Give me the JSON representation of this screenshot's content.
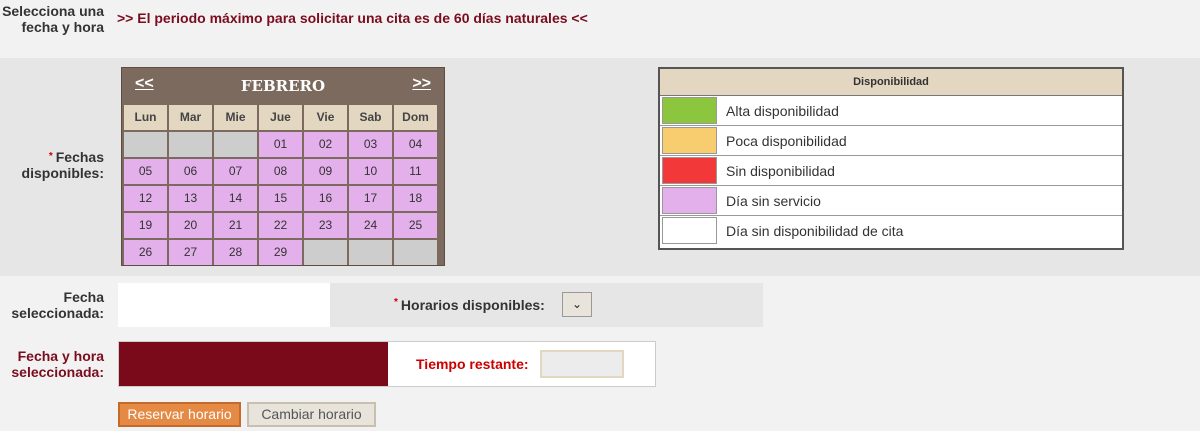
{
  "header": {
    "label": "Selecciona una fecha y hora",
    "notice": ">> El periodo máximo para solicitar una cita es de 60 días naturales <<"
  },
  "dates": {
    "required_mark": "*",
    "label": "Fechas disponibles:"
  },
  "calendar": {
    "prev": "<<",
    "next": ">>",
    "month": "FEBRERO",
    "weekdays": [
      "Lun",
      "Mar",
      "Mie",
      "Jue",
      "Vie",
      "Sab",
      "Dom"
    ],
    "weeks": [
      [
        "",
        "",
        "",
        "01",
        "02",
        "03",
        "04"
      ],
      [
        "05",
        "06",
        "07",
        "08",
        "09",
        "10",
        "11"
      ],
      [
        "12",
        "13",
        "14",
        "15",
        "16",
        "17",
        "18"
      ],
      [
        "19",
        "20",
        "21",
        "22",
        "23",
        "24",
        "25"
      ],
      [
        "26",
        "27",
        "28",
        "29",
        "",
        "",
        ""
      ]
    ],
    "day_status": "sin-servicio"
  },
  "legend": {
    "title": "Disponibilidad",
    "items": [
      {
        "label": "Alta disponibilidad",
        "color": "#8cc63f"
      },
      {
        "label": "Poca disponibilidad",
        "color": "#f7cd6f"
      },
      {
        "label": "Sin disponibilidad",
        "color": "#f23838"
      },
      {
        "label": "Día sin servicio",
        "color": "#e4b0ec"
      },
      {
        "label": "Día sin disponibilidad de cita",
        "color": "#ffffff"
      }
    ]
  },
  "selection": {
    "date_label": "Fecha seleccionada:",
    "date_value": "",
    "horarios_required_mark": "*",
    "horarios_label": "Horarios disponibles:",
    "horarios_selected": ""
  },
  "final": {
    "label": "Fecha y hora seleccionada:",
    "value": "",
    "time_label": "Tiempo restante:",
    "time_value": "",
    "value_color": "#7a0a1a"
  },
  "buttons": {
    "reserve": "Reservar horario",
    "change": "Cambiar horario"
  }
}
